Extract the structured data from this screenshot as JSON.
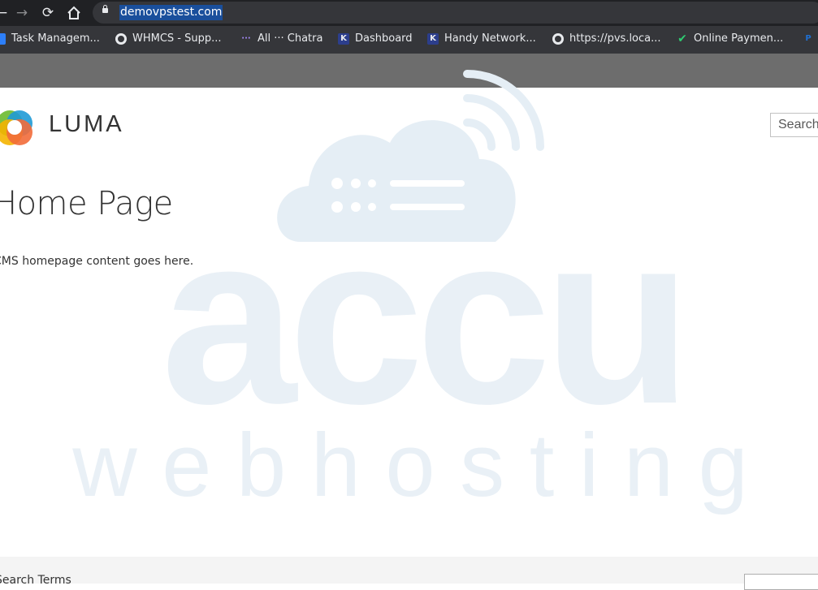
{
  "browser": {
    "url": "demovpstest.com",
    "bookmarks": [
      {
        "label": "Task Managem...",
        "icon": "task-icon"
      },
      {
        "label": "WHMCS - Supp...",
        "icon": "globe-icon"
      },
      {
        "label": "All ··· Chatra",
        "icon": "chatra-icon"
      },
      {
        "label": "Dashboard",
        "icon": "k-icon"
      },
      {
        "label": "Handy Network...",
        "icon": "k-icon"
      },
      {
        "label": "https://pvs.loca...",
        "icon": "globe-icon"
      },
      {
        "label": "Online Paymen...",
        "icon": "check-icon"
      }
    ]
  },
  "header": {
    "logo_text": "LUMA",
    "search_placeholder": "Search entire store here..."
  },
  "main": {
    "title": "Home Page",
    "content": "CMS homepage content goes here."
  },
  "footer": {
    "link": "Search Terms"
  },
  "watermark": {
    "line1": "accu",
    "line2": "w e b   h o s t i n g",
    "color": "#dce8f2"
  }
}
